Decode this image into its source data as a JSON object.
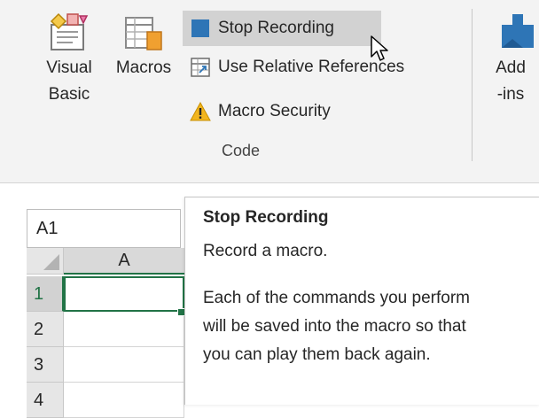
{
  "ribbon": {
    "visual_basic_label": "Visual Basic",
    "macros_label": "Macros",
    "stop_recording_label": "Stop Recording",
    "relative_references_label": "Use Relative References",
    "macro_security_label": "Macro Security",
    "group_label": "Code",
    "addins_label": "Add-ins"
  },
  "name_box": {
    "value": "A1"
  },
  "grid": {
    "column_header": "A",
    "rows": [
      "1",
      "2",
      "3",
      "4"
    ]
  },
  "tooltip": {
    "title": "Stop Recording",
    "description": "Record a macro.",
    "detail": "Each of the commands you perform will be saved into the macro so that you can play them back again."
  },
  "colors": {
    "accent_green": "#217346",
    "ribbon_bg": "#f3f3f3",
    "stop_square": "#2e75b6"
  }
}
